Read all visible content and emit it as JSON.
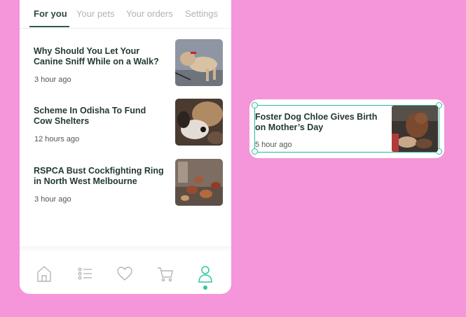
{
  "tabs": [
    "For you",
    "Your pets",
    "Your orders",
    "Settings"
  ],
  "active_tab": "For you",
  "articles": [
    {
      "title": "Why Should You Let Your Canine Sniff While on a Walk?",
      "time": "3 hour ago"
    },
    {
      "title": "Scheme In Odisha To Fund Cow Shelters",
      "time": "12 hours ago"
    },
    {
      "title": "RSPCA Bust Cockfighting Ring in North West Melbourne",
      "time": "3 hour ago"
    }
  ],
  "dragged_card": {
    "title": "Foster Dog Chloe Gives Birth on Mother’s Day",
    "time": "5 hour ago"
  },
  "nav": [
    "home-icon",
    "list-icon",
    "heart-icon",
    "cart-icon",
    "profile-icon"
  ],
  "active_nav": "profile-icon",
  "colors": {
    "background": "#f496d9",
    "accent": "#2ec6a3",
    "title": "#233a31",
    "selection": "#2bb6a0"
  }
}
